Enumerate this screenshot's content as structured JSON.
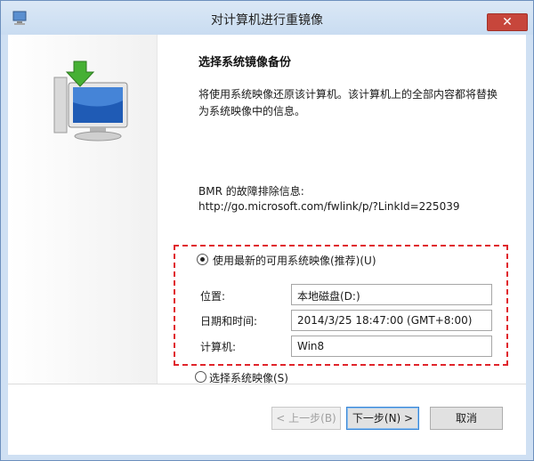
{
  "window": {
    "title": "对计算机进行重镜像",
    "close_glyph": "✕"
  },
  "content": {
    "heading": "选择系统镜像备份",
    "description": "将使用系统映像还原该计算机。该计算机上的全部内容都将替换为系统映像中的信息。",
    "bmr_label": "BMR 的故障排除信息:",
    "bmr_link": "http://go.microsoft.com/fwlink/p/?LinkId=225039"
  },
  "options": {
    "latest_label": "使用最新的可用系统映像(推荐)(U)",
    "latest_selected": true,
    "choose_label": "选择系统映像(S)",
    "choose_selected": false
  },
  "details": {
    "location_label": "位置:",
    "location_value": "本地磁盘(D:)",
    "datetime_label": "日期和时间:",
    "datetime_value": "2014/3/25 18:47:00 (GMT+8:00)",
    "computer_label": "计算机:",
    "computer_value": "Win8"
  },
  "buttons": {
    "back": "< 上一步(B)",
    "next": "下一步(N) >",
    "cancel": "取消"
  },
  "colors": {
    "highlight_border": "#e0252b",
    "title_bar": "#cfe0f3",
    "close_button": "#c7463b"
  }
}
